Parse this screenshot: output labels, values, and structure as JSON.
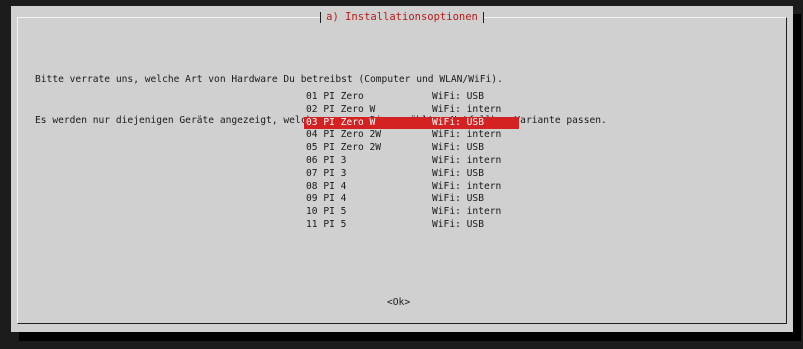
{
  "dialog": {
    "title": "a) Installationsoptionen",
    "intro_lines": [
      "Bitte verrate uns, welche Art von Hardware Du betreibst (Computer und WLAN/WiFi).",
      "Es werden nur diejenigen Geräte angezeigt, welche zur von Dir gewählten Notfallbox-Variante passen."
    ],
    "menu": {
      "items": [
        {
          "tag": "01 PI Zero",
          "desc": "WiFi: USB",
          "selected": false
        },
        {
          "tag": "02 PI Zero W",
          "desc": "WiFi: intern",
          "selected": false
        },
        {
          "tag": "03 PI Zero W",
          "desc": "WiFi: USB",
          "selected": true
        },
        {
          "tag": "04 PI Zero 2W",
          "desc": "WiFi: intern",
          "selected": false
        },
        {
          "tag": "05 PI Zero 2W",
          "desc": "WiFi: USB",
          "selected": false
        },
        {
          "tag": "06 PI 3",
          "desc": "WiFi: intern",
          "selected": false
        },
        {
          "tag": "07 PI 3",
          "desc": "WiFi: USB",
          "selected": false
        },
        {
          "tag": "08 PI 4",
          "desc": "WiFi: intern",
          "selected": false
        },
        {
          "tag": "09 PI 4",
          "desc": "WiFi: USB",
          "selected": false
        },
        {
          "tag": "10 PI 5",
          "desc": "WiFi: intern",
          "selected": false
        },
        {
          "tag": "11 PI 5",
          "desc": "WiFi: USB",
          "selected": false
        }
      ]
    },
    "ok_label": "<Ok>"
  },
  "colors": {
    "dialog_bg": "#d0d0d0",
    "title_text": "#b71c1c",
    "selection_bg": "#d42121",
    "selection_text": "#ffffff",
    "screen_bg": "#1c1c1c"
  }
}
